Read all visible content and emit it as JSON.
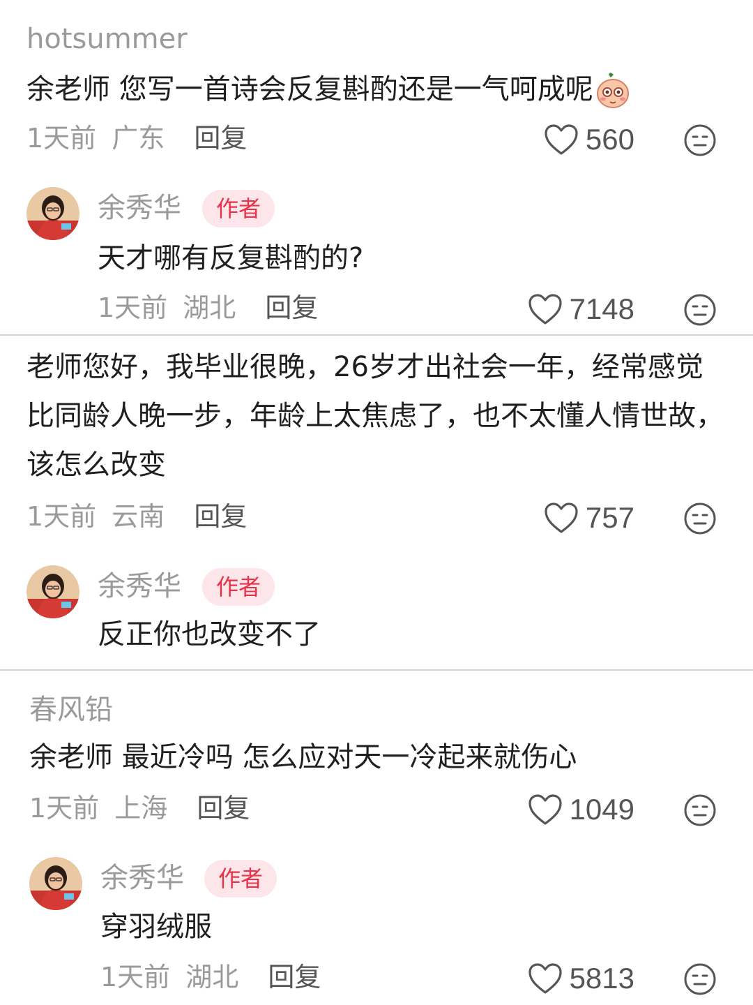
{
  "comments": [
    {
      "username": "hotsummer",
      "text": "余老师 您写一首诗会反复斟酌还是一气呵成呢",
      "emoji": "blush-cartoon-icon",
      "time": "1天前",
      "location": "广东",
      "reply_label": "回复",
      "likes": "560",
      "author_reply": {
        "username": "余秀华",
        "badge": "作者",
        "text": "天才哪有反复斟酌的?",
        "time": "1天前",
        "location": "湖北",
        "reply_label": "回复",
        "likes": "7148"
      }
    },
    {
      "username": "",
      "text": "老师您好，我毕业很晚，26岁才出社会一年，经常感觉比同龄人晚一步，年龄上太焦虑了，也不太懂人情世故，该怎么改变",
      "time": "1天前",
      "location": "云南",
      "reply_label": "回复",
      "likes": "757",
      "author_reply": {
        "username": "余秀华",
        "badge": "作者",
        "text": "反正你也改变不了"
      }
    },
    {
      "username": "春风铅",
      "text": "余老师 最近冷吗 怎么应对天一冷起来就伤心",
      "time": "1天前",
      "location": "上海",
      "reply_label": "回复",
      "likes": "1049",
      "author_reply": {
        "username": "余秀华",
        "badge": "作者",
        "text": "穿羽绒服",
        "time": "1天前",
        "location": "湖北",
        "reply_label": "回复",
        "likes": "5813"
      }
    }
  ],
  "icons": {
    "like": "heart-outline-icon",
    "dislike": "neutral-face-icon",
    "avatar": "author-avatar"
  },
  "colors": {
    "badge_bg": "#fde6ea",
    "badge_text": "#e8324a",
    "meta_text": "#9a9a9a",
    "divider": "#d6d6d6"
  }
}
